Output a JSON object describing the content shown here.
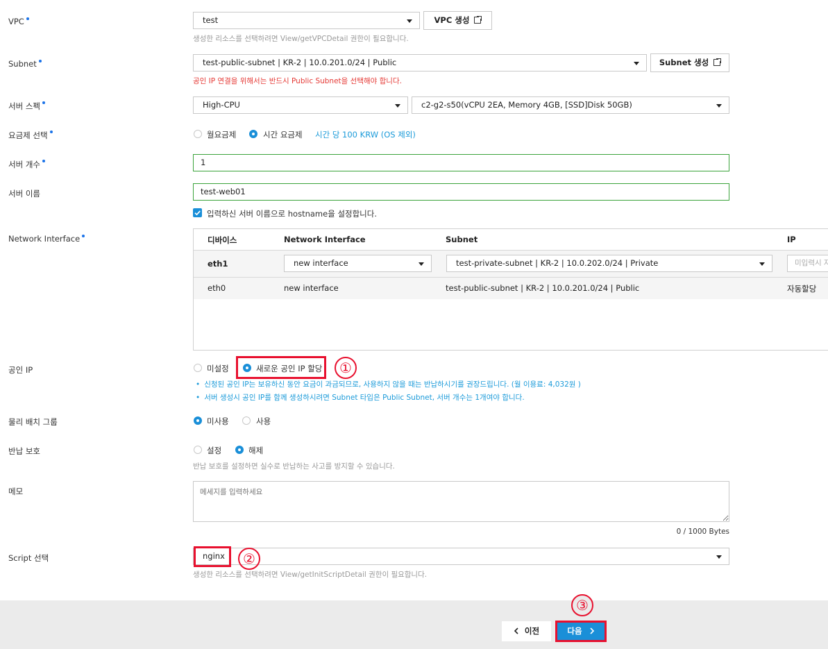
{
  "vpc": {
    "label": "VPC",
    "value": "test",
    "create_button": "VPC 생성",
    "help": "생성한 리소스를 선택하려면 View/getVPCDetail 권한이 필요합니다."
  },
  "subnet": {
    "label": "Subnet",
    "value": "test-public-subnet | KR-2 | 10.0.201.0/24 | Public",
    "create_button": "Subnet 생성",
    "warning": "공인 IP 연결을 위해서는 반드시 Public Subnet을 선택해야 합니다."
  },
  "server_spec": {
    "label": "서버 스펙",
    "type": "High-CPU",
    "spec": "c2-g2-s50(vCPU 2EA, Memory 4GB, [SSD]Disk 50GB)"
  },
  "pricing": {
    "label": "요금제 선택",
    "monthly": "월요금제",
    "hourly": "시간 요금제",
    "price": "시간 당 100 KRW (OS 제외)"
  },
  "server_count": {
    "label": "서버 개수",
    "value": "1"
  },
  "server_name": {
    "label": "서버 이름",
    "value": "test-web01",
    "hostname_check": "입력하신 서버 이름으로 hostname을 설정합니다."
  },
  "network_interface": {
    "label": "Network Interface",
    "headers": [
      "디바이스",
      "Network Interface",
      "Subnet",
      "IP"
    ],
    "row1": {
      "device": "eth1",
      "interface": "new interface",
      "subnet": "test-private-subnet | KR-2 | 10.0.202.0/24 | Private",
      "ip_placeholder": "미입력시 자"
    },
    "row2": {
      "device": "eth0",
      "interface": "new interface",
      "subnet": "test-public-subnet | KR-2 | 10.0.201.0/24 | Public",
      "ip": "자동할당"
    }
  },
  "public_ip": {
    "label": "공인 IP",
    "none": "미설정",
    "new": "새로운 공인 IP 할당",
    "note1": "신청된 공인 IP는 보유하신 동안 요금이 과금되므로, 사용하지 않을 때는 반납하시기를 권장드립니다. (월 이용료: 4,032원 )",
    "note2": "서버 생성시 공인 IP를 함께 생성하시려면 Subnet 타입은 Public Subnet, 서버 개수는 1개여야 합니다."
  },
  "placement_group": {
    "label": "물리 배치 그룹",
    "unused": "미사용",
    "used": "사용"
  },
  "return_protection": {
    "label": "반납 보호",
    "on": "설정",
    "off": "해제",
    "help": "반납 보호를 설정하면 실수로 반납하는 사고를 방지할 수 있습니다."
  },
  "memo": {
    "label": "메모",
    "placeholder": "메세지를 입력하세요",
    "counter": "0 / 1000 Bytes"
  },
  "script": {
    "label": "Script 선택",
    "value": "nginx",
    "help": "생성한 리소스를 선택하려면 View/getInitScriptDetail 권한이 필요합니다."
  },
  "footer": {
    "prev": "이전",
    "next": "다음"
  },
  "annotations": {
    "one": "①",
    "two": "②",
    "three": "③"
  },
  "colors": {
    "accent": "#1a8fd8",
    "annotation": "#e8102e",
    "valid_border": "#3aa33a",
    "warning": "#e53935"
  }
}
